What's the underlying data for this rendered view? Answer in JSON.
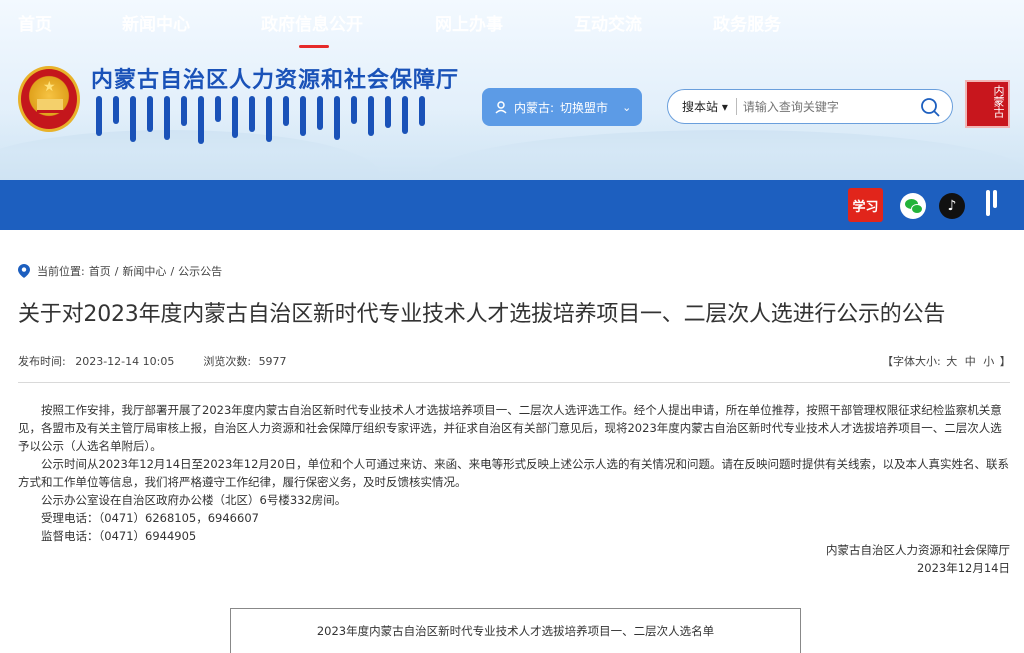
{
  "header": {
    "site_title": "内蒙古自治区人力资源和社会保障厅",
    "region_label": "内蒙古:",
    "region_switch": "切换盟市",
    "search_scope": "搜本站 ▾",
    "search_placeholder": "请输入查询关键字",
    "seal_text": "内蒙古"
  },
  "nav": {
    "items": [
      "首页",
      "新闻中心",
      "政府信息公开",
      "网上办事",
      "互动交流",
      "政务服务"
    ],
    "active_index": 2,
    "xuexi_label": "学习"
  },
  "breadcrumb": {
    "prefix": "当前位置:",
    "items": [
      "首页",
      "新闻中心",
      "公示公告"
    ],
    "separator": "/"
  },
  "article": {
    "title": "关于对2023年度内蒙古自治区新时代专业技术人才选拔培养项目一、二层次人选进行公示的公告",
    "publish_label": "发布时间:",
    "publish_time": "2023-12-14 10:05",
    "views_label": "浏览次数:",
    "views": "5977",
    "fontsize_prefix": "【字体大小:",
    "fontsize_large": "大",
    "fontsize_medium": "中",
    "fontsize_small": "小",
    "fontsize_suffix": "】",
    "paragraphs": [
      "按照工作安排，我厅部署开展了2023年度内蒙古自治区新时代专业技术人才选拔培养项目一、二层次人选评选工作。经个人提出申请，所在单位推荐，按照干部管理权限征求纪检监察机关意见，各盟市及有关主管厅局审核上报，自治区人力资源和社会保障厅组织专家评选，并征求自治区有关部门意见后，现将2023年度内蒙古自治区新时代专业技术人才选拔培养项目一、二层次人选予以公示（人选名单附后）。",
      "公示时间从2023年12月14日至2023年12月20日，单位和个人可通过来访、来函、来电等形式反映上述公示人选的有关情况和问题。请在反映问题时提供有关线索，以及本人真实姓名、联系方式和工作单位等信息，我们将严格遵守工作纪律，履行保密义务，及时反馈核实情况。",
      "公示办公室设在自治区政府办公楼（北区）6号楼332房间。"
    ],
    "phone_accept": "受理电话：（0471）6268105，6946607",
    "phone_supervise": "监督电话：（0471）6944905",
    "signature_org": "内蒙古自治区人力资源和社会保障厅",
    "signature_date": "2023年12月14日",
    "table_caption": "2023年度内蒙古自治区新时代专业技术人才选拔培养项目一、二层次人选名单"
  },
  "colors": {
    "nav_bg": "#1d5fbf",
    "title_blue": "#1a52b8",
    "region_btn": "#5c9be6",
    "active_underline": "#e62a2a"
  },
  "icons": [
    "national-emblem-icon",
    "location-icon",
    "chevron-down-icon",
    "search-icon",
    "xuexi-icon",
    "wechat-icon",
    "tiktok-icon",
    "map-pin-icon"
  ]
}
